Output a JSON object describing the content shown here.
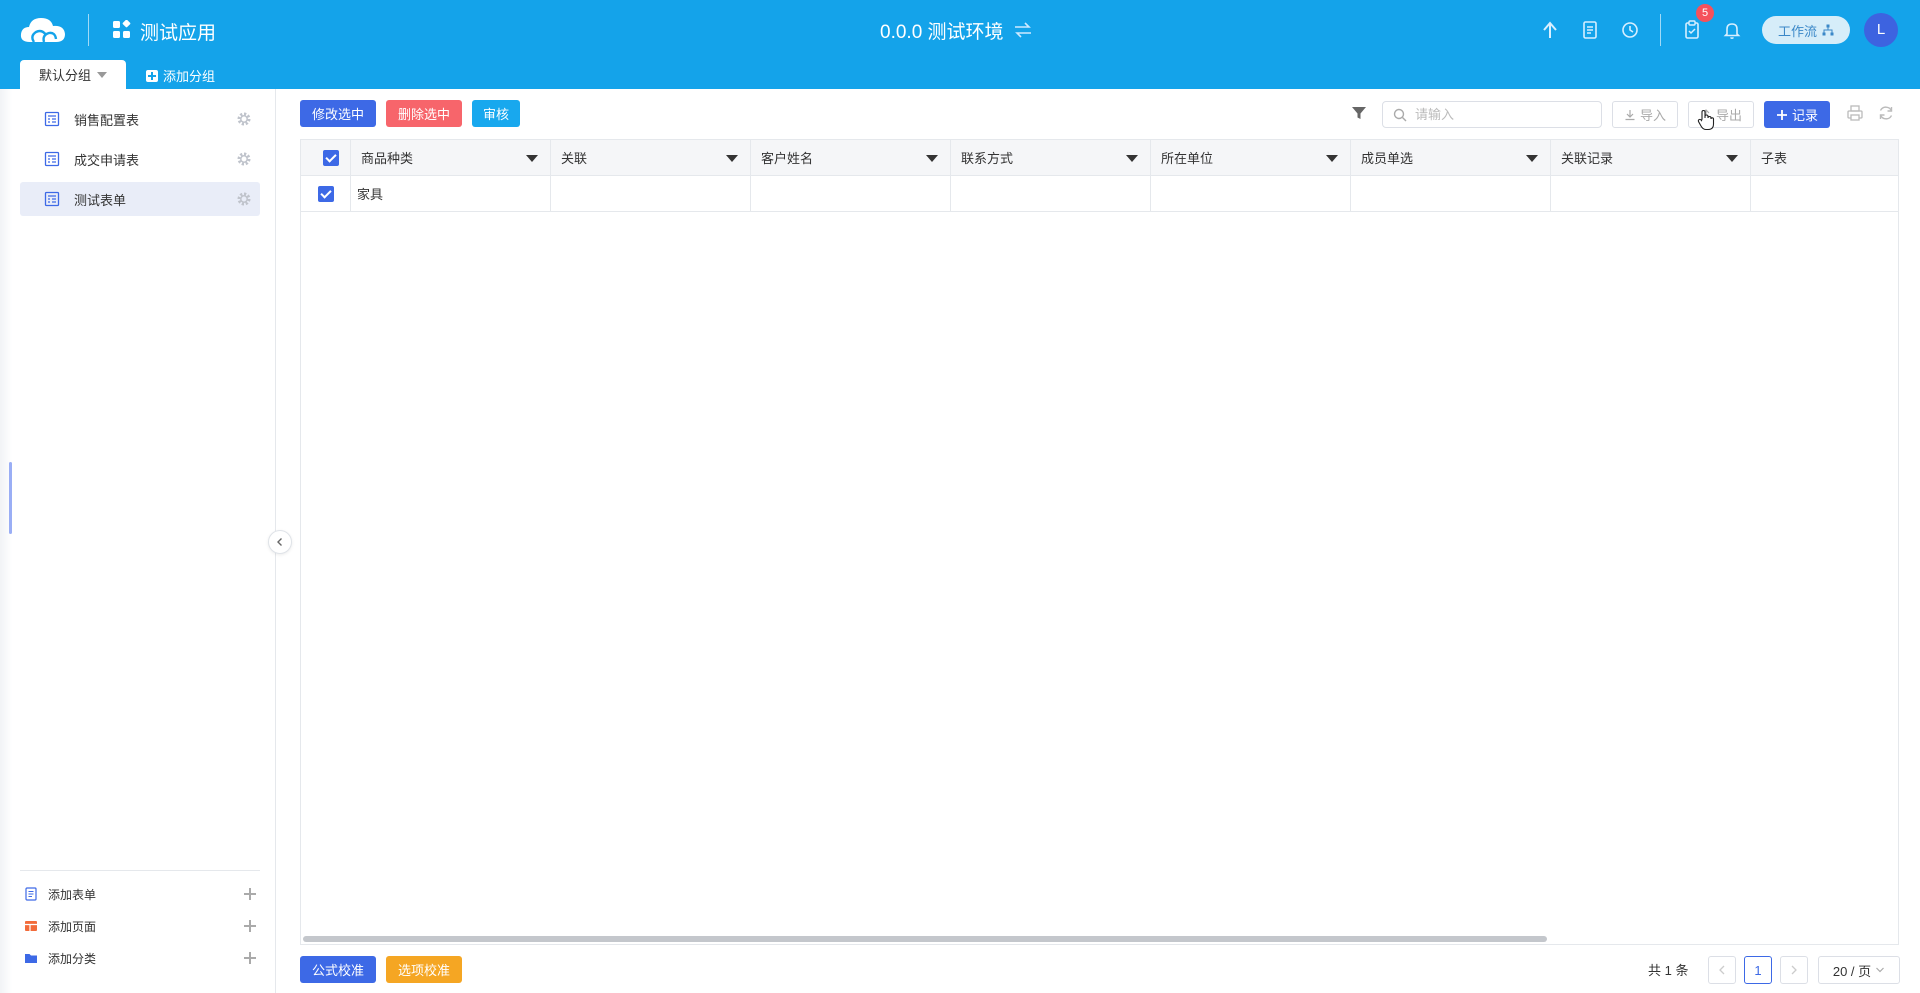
{
  "header": {
    "app_title": "测试应用",
    "env_title": "0.0.0 测试环境",
    "notification_count": "5",
    "workflow_label": "工作流",
    "avatar_initial": "L",
    "bg_color": "#14a3ea"
  },
  "group_tabs": {
    "active_label": "默认分组",
    "add_label": "添加分组"
  },
  "sidebar": {
    "items": [
      {
        "label": "销售配置表",
        "icon": "form-icon"
      },
      {
        "label": "成交申请表",
        "icon": "form-icon"
      },
      {
        "label": "测试表单",
        "icon": "form-icon",
        "active": true
      }
    ],
    "bottom": [
      {
        "label": "添加表单",
        "icon": "form-add-icon"
      },
      {
        "label": "添加页面",
        "icon": "page-add-icon"
      },
      {
        "label": "添加分类",
        "icon": "folder-add-icon"
      }
    ]
  },
  "toolbar": {
    "edit_selected": "修改选中",
    "delete_selected": "删除选中",
    "review": "审核",
    "search_placeholder": "请输入",
    "import_label": "导入",
    "export_label": "导出",
    "record_label": "记录"
  },
  "table": {
    "columns": [
      "商品种类",
      "关联",
      "客户姓名",
      "联系方式",
      "所在单位",
      "成员单选",
      "关联记录",
      "子表"
    ],
    "rows": [
      {
        "checked": true,
        "cells": [
          "家具",
          "",
          "",
          "",
          "",
          "",
          "",
          ""
        ]
      }
    ]
  },
  "footer": {
    "formula_check": "公式校准",
    "option_check": "选项校准",
    "total": "共 1 条",
    "current_page": "1",
    "page_size": "20 / 页"
  },
  "colors": {
    "primary": "#3d69e6",
    "danger": "#f7656b",
    "info": "#18a8ee",
    "warning": "#f5a623"
  }
}
